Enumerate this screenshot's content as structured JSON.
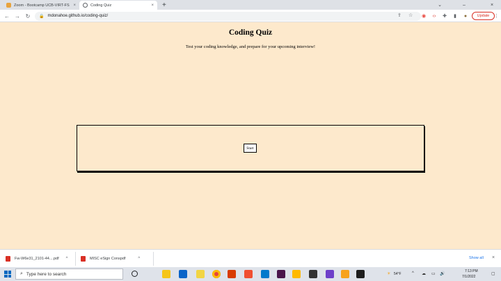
{
  "browser": {
    "tabs": [
      {
        "title": "Zoom - Bootcamp UCB-VIRT-FS",
        "favicon_color": "#e8a33d",
        "close": "×"
      },
      {
        "title": "Coding Quiz",
        "favicon_color": "#5f6368",
        "close": "×"
      }
    ],
    "new_tab": "+",
    "window_controls": [
      "⌄",
      "–",
      "×"
    ],
    "back": "←",
    "forward": "→",
    "reload": "↻",
    "url": "mdonahoe.github.io/coding-quiz/",
    "update_label": "Update",
    "toolbar_icons": [
      "⇪",
      "☆",
      "◉",
      "‹›",
      "✚",
      "▮",
      "●",
      "⋮"
    ]
  },
  "page": {
    "title": "Coding Quiz",
    "subtitle": "Test your coding knowledge, and prepare for your upcoming interview!",
    "start_label": "Start"
  },
  "downloads": {
    "items": [
      {
        "name": "Fw-W6e31_2101-44....pdf",
        "chevron": "^"
      },
      {
        "name": "MISC eSign Conspdf",
        "chevron": "^"
      }
    ],
    "show_all": "Show all",
    "close": "×"
  },
  "taskbar": {
    "search_placeholder": "Type here to search",
    "search_icon": "⌕",
    "weather": "54°F",
    "time": "7:13 PM",
    "date": "7/1/2022",
    "icons": [
      {
        "name": "task-view-icon",
        "color": "#202124"
      },
      {
        "name": "file-explorer-icon",
        "color": "#f5c518"
      },
      {
        "name": "mail-icon",
        "color": "#0a64c8"
      },
      {
        "name": "notes-icon",
        "color": "#f2d544"
      },
      {
        "name": "chrome-icon",
        "color": "#e8453c"
      },
      {
        "name": "app-icon-red",
        "color": "#d83b01"
      },
      {
        "name": "git-icon",
        "color": "#f05032"
      },
      {
        "name": "vscode-icon",
        "color": "#007acc"
      },
      {
        "name": "slack-icon",
        "color": "#4a154b"
      },
      {
        "name": "app-icon-yellow",
        "color": "#ffb900"
      },
      {
        "name": "github-icon",
        "color": "#333333"
      },
      {
        "name": "app-icon-purple",
        "color": "#6e40c9"
      },
      {
        "name": "app-icon-orange",
        "color": "#f7a21b"
      },
      {
        "name": "terminal-icon",
        "color": "#1e1e1e"
      }
    ],
    "tray_icons": [
      "^",
      "☁",
      "▭",
      "🔊"
    ]
  },
  "colors": {
    "page_background": "#fde9cc",
    "quiz_border": "#000000",
    "update_red": "#d93025",
    "link_blue": "#1a73e8"
  }
}
